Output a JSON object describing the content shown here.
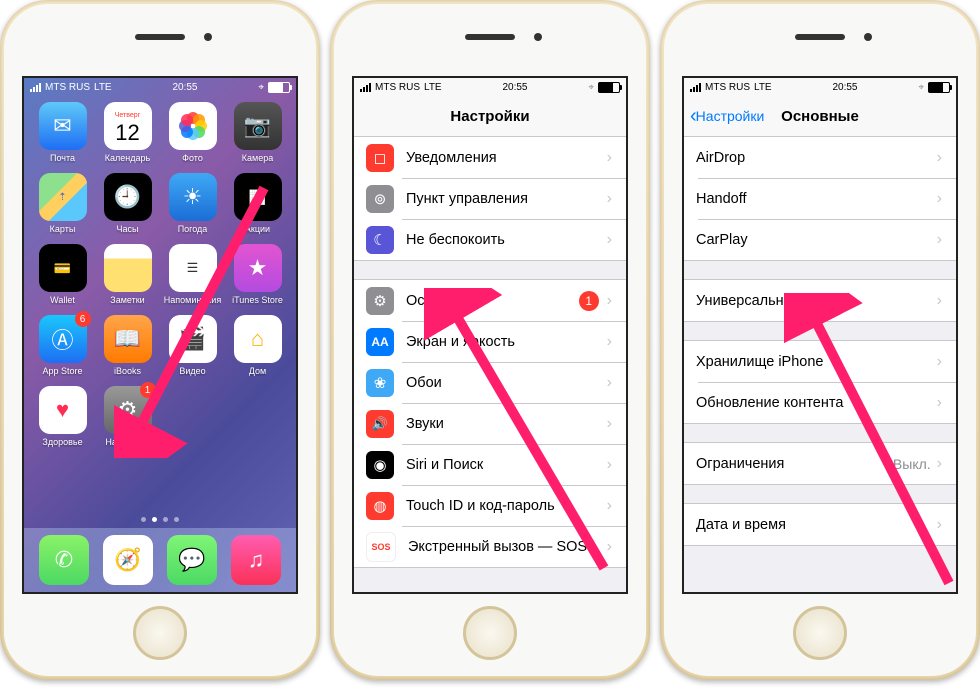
{
  "status": {
    "carrier": "MTS RUS",
    "network": "LTE",
    "time": "20:55"
  },
  "phone1": {
    "calendar_day": "Четверг",
    "calendar_date": "12",
    "apps_row1": [
      {
        "label": "Почта",
        "name": "mail"
      },
      {
        "label": "Календарь",
        "name": "calendar"
      },
      {
        "label": "Фото",
        "name": "photos"
      },
      {
        "label": "Камера",
        "name": "camera"
      }
    ],
    "apps_row2": [
      {
        "label": "Карты",
        "name": "maps"
      },
      {
        "label": "Часы",
        "name": "clock"
      },
      {
        "label": "Погода",
        "name": "weather"
      },
      {
        "label": "Акции",
        "name": "stocks"
      }
    ],
    "apps_row3": [
      {
        "label": "Wallet",
        "name": "wallet"
      },
      {
        "label": "Заметки",
        "name": "notes"
      },
      {
        "label": "Напоминания",
        "name": "reminders"
      },
      {
        "label": "iTunes Store",
        "name": "itunes"
      }
    ],
    "apps_row4": [
      {
        "label": "App Store",
        "name": "appstore",
        "badge": "6"
      },
      {
        "label": "iBooks",
        "name": "ibooks"
      },
      {
        "label": "Видео",
        "name": "video"
      },
      {
        "label": "Дом",
        "name": "home"
      }
    ],
    "apps_row5": [
      {
        "label": "Здоровье",
        "name": "health"
      },
      {
        "label": "Настройки",
        "name": "settings",
        "badge": "1"
      }
    ],
    "dock": [
      {
        "name": "phone"
      },
      {
        "name": "safari"
      },
      {
        "name": "messages"
      },
      {
        "name": "music"
      }
    ]
  },
  "phone2": {
    "title": "Настройки",
    "group1": [
      {
        "label": "Уведомления",
        "iconClass": "row-icon-red",
        "glyph": "◻"
      },
      {
        "label": "Пункт управления",
        "iconClass": "row-icon-gray",
        "glyph": "⊙"
      },
      {
        "label": "Не беспокоить",
        "iconClass": "row-icon-indigo",
        "glyph": "☾"
      }
    ],
    "group2": [
      {
        "label": "Основные",
        "iconClass": "row-icon-gray",
        "glyph": "⚙",
        "badge": "1"
      },
      {
        "label": "Экран и яркость",
        "iconClass": "row-icon-blue",
        "glyph": "A"
      },
      {
        "label": "Обои",
        "iconClass": "row-icon-cyan",
        "glyph": "❀"
      },
      {
        "label": "Звуки",
        "iconClass": "row-icon-red",
        "glyph": "🔊"
      },
      {
        "label": "Siri и Поиск",
        "iconClass": "row-icon-black",
        "glyph": "◉"
      },
      {
        "label": "Touch ID и код-пароль",
        "iconClass": "row-icon-red",
        "glyph": "◍"
      },
      {
        "label": "Экстренный вызов — SOS",
        "iconClass": "row-icon-orange",
        "glyph": "SOS"
      }
    ]
  },
  "phone3": {
    "back": "Настройки",
    "title": "Основные",
    "group1": [
      {
        "label": "AirDrop"
      },
      {
        "label": "Handoff"
      },
      {
        "label": "CarPlay"
      }
    ],
    "group2": [
      {
        "label": "Универсальный доступ"
      }
    ],
    "group3": [
      {
        "label": "Хранилище iPhone"
      },
      {
        "label": "Обновление контента"
      }
    ],
    "group4": [
      {
        "label": "Ограничения",
        "detail": "Выкл."
      }
    ],
    "group5": [
      {
        "label": "Дата и время"
      }
    ]
  }
}
